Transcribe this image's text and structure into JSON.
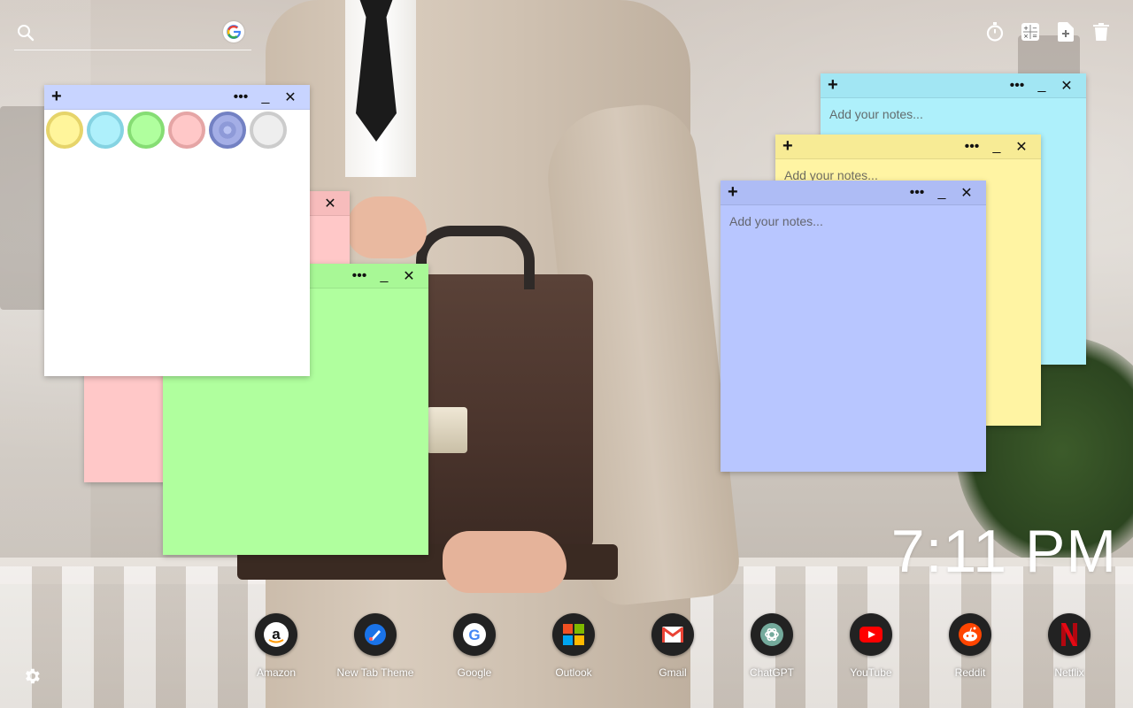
{
  "search": {
    "placeholder": ""
  },
  "tools": [
    {
      "name": "timer-icon"
    },
    {
      "name": "calculator-icon"
    },
    {
      "name": "add-note-icon"
    },
    {
      "name": "trash-icon"
    }
  ],
  "notes": {
    "placeholder": "Add your notes...",
    "more_label": "•••",
    "minimize_label": "_",
    "close_label": "✕",
    "add_label": "+"
  },
  "palette": [
    {
      "name": "yellow",
      "fill": "#fff59b",
      "ring": "#e6d46a"
    },
    {
      "name": "blue",
      "fill": "#aef0fb",
      "ring": "#85d3e2"
    },
    {
      "name": "green",
      "fill": "#b0ff9e",
      "ring": "#86dd74"
    },
    {
      "name": "pink",
      "fill": "#ffc8c8",
      "ring": "#e5a5a5"
    },
    {
      "name": "purple",
      "fill": "#8e9ad8",
      "ring": "#7381c3",
      "selected": true
    },
    {
      "name": "white",
      "fill": "#eeeeee",
      "ring": "#cccccc"
    }
  ],
  "clock": {
    "time": "7:11 PM"
  },
  "dock": [
    {
      "label": "Amazon"
    },
    {
      "label": "New Tab Theme"
    },
    {
      "label": "Google"
    },
    {
      "label": "Outlook"
    },
    {
      "label": "Gmail"
    },
    {
      "label": "ChatGPT"
    },
    {
      "label": "YouTube"
    },
    {
      "label": "Reddit"
    },
    {
      "label": "Netflix"
    }
  ]
}
